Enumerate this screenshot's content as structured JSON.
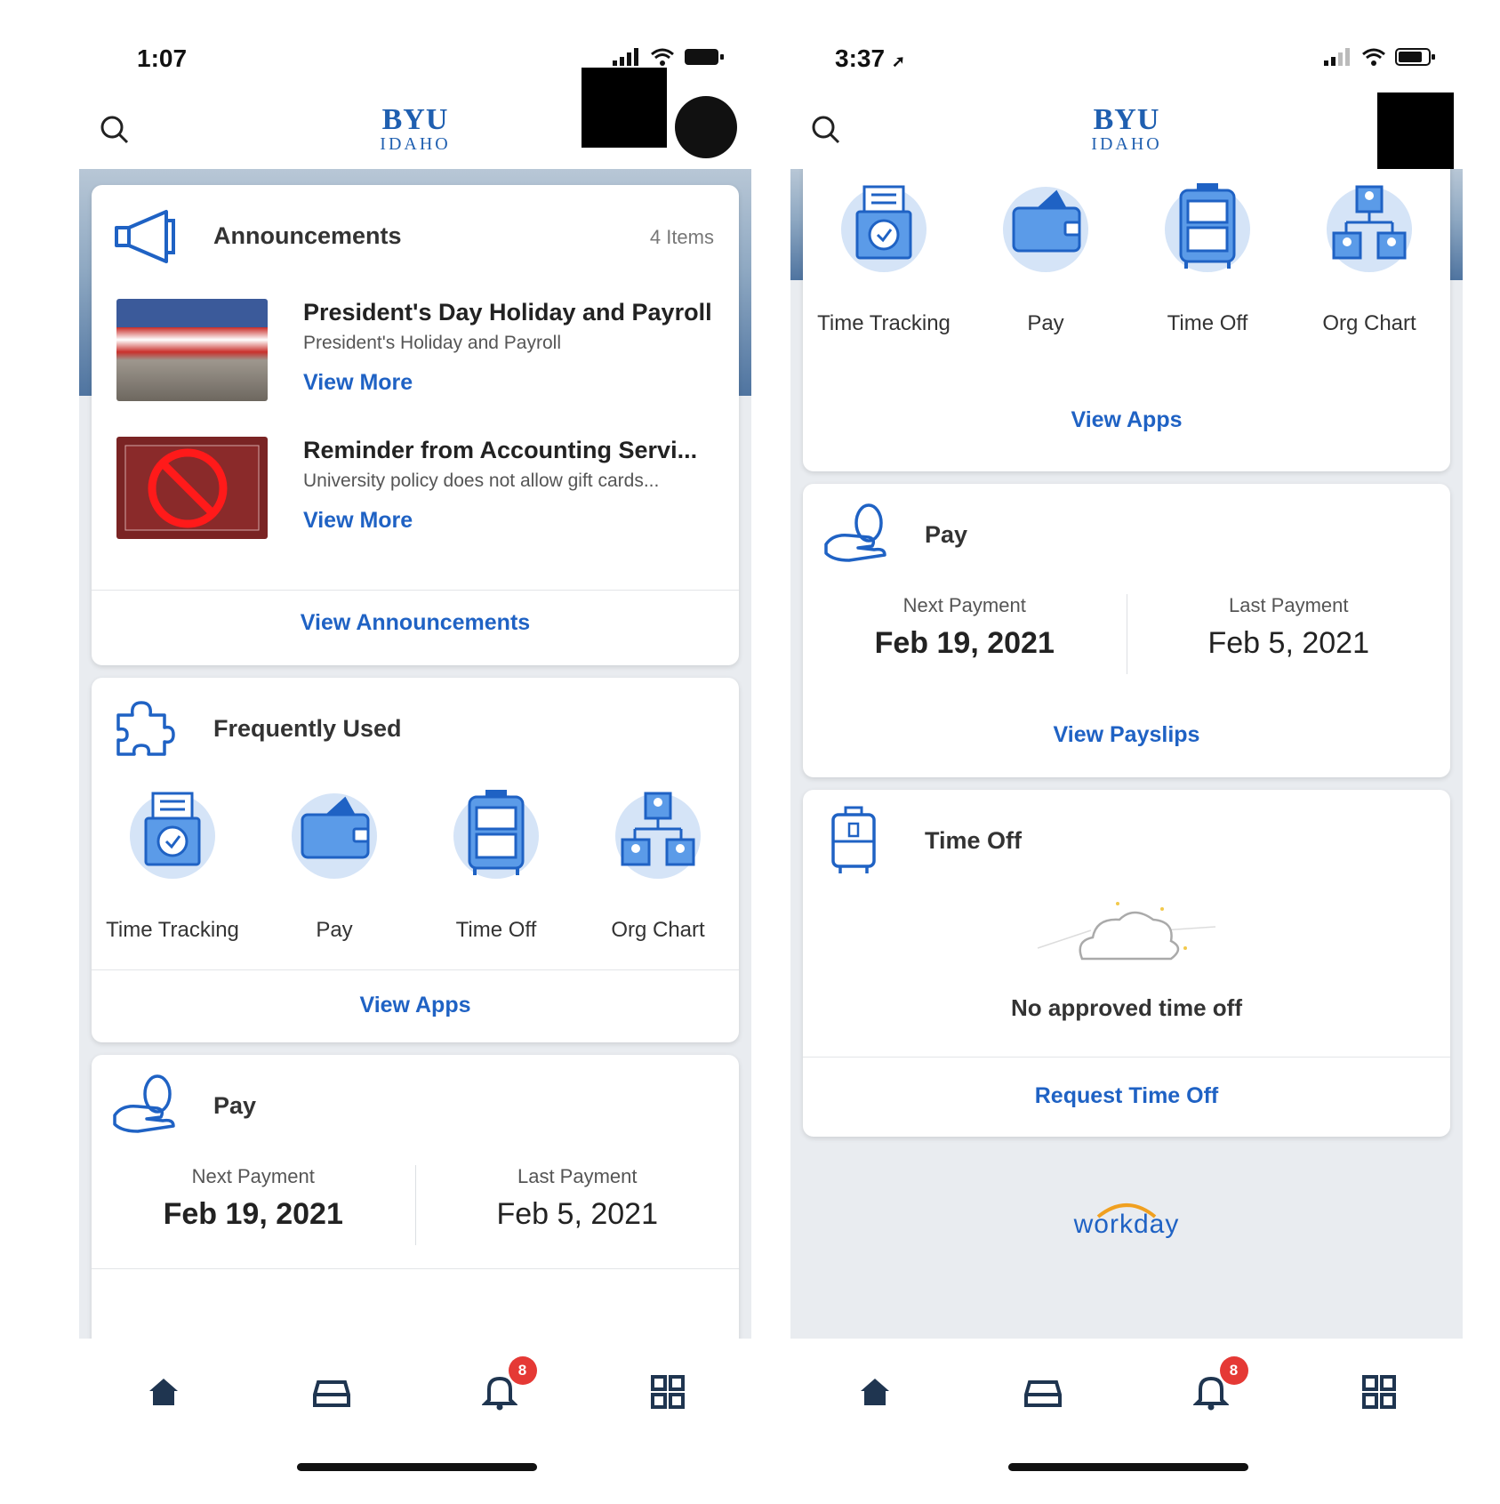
{
  "left": {
    "status_time": "1:07",
    "logo": {
      "line1": "BYU",
      "line2": "IDAHO"
    },
    "announcements": {
      "title": "Announcements",
      "count": "4 Items",
      "items": [
        {
          "title": "President's Day Holiday and Payroll",
          "subtitle": "President's Holiday and Payroll",
          "link": "View More"
        },
        {
          "title": "Reminder from Accounting Servi...",
          "subtitle": "University policy does not allow gift cards...",
          "link": "View More"
        }
      ],
      "footer": "View Announcements"
    },
    "frequently_used": {
      "title": "Frequently Used",
      "apps": [
        {
          "label": "Time Tracking",
          "icon": "time-tracking-icon"
        },
        {
          "label": "Pay",
          "icon": "wallet-icon"
        },
        {
          "label": "Time Off",
          "icon": "suitcase-icon"
        },
        {
          "label": "Org Chart",
          "icon": "org-chart-icon"
        }
      ],
      "footer": "View Apps"
    },
    "pay": {
      "title": "Pay",
      "next_label": "Next Payment",
      "next_value": "Feb 19, 2021",
      "last_label": "Last Payment",
      "last_value": "Feb 5, 2021"
    },
    "badge_count": "8"
  },
  "right": {
    "status_time": "3:37",
    "logo": {
      "line1": "BYU",
      "line2": "IDAHO"
    },
    "apps": [
      {
        "label": "Time Tracking",
        "icon": "time-tracking-icon"
      },
      {
        "label": "Pay",
        "icon": "wallet-icon"
      },
      {
        "label": "Time Off",
        "icon": "suitcase-icon"
      },
      {
        "label": "Org Chart",
        "icon": "org-chart-icon"
      }
    ],
    "apps_footer": "View Apps",
    "pay": {
      "title": "Pay",
      "next_label": "Next Payment",
      "next_value": "Feb 19, 2021",
      "last_label": "Last Payment",
      "last_value": "Feb 5, 2021",
      "footer": "View Payslips"
    },
    "time_off": {
      "title": "Time Off",
      "empty_text": "No approved time off",
      "footer": "Request Time Off"
    },
    "brand": "workday",
    "badge_count": "8"
  },
  "colors": {
    "accent": "#1f62c4",
    "badge": "#e53935",
    "app_circle": "#d5e4f7"
  }
}
